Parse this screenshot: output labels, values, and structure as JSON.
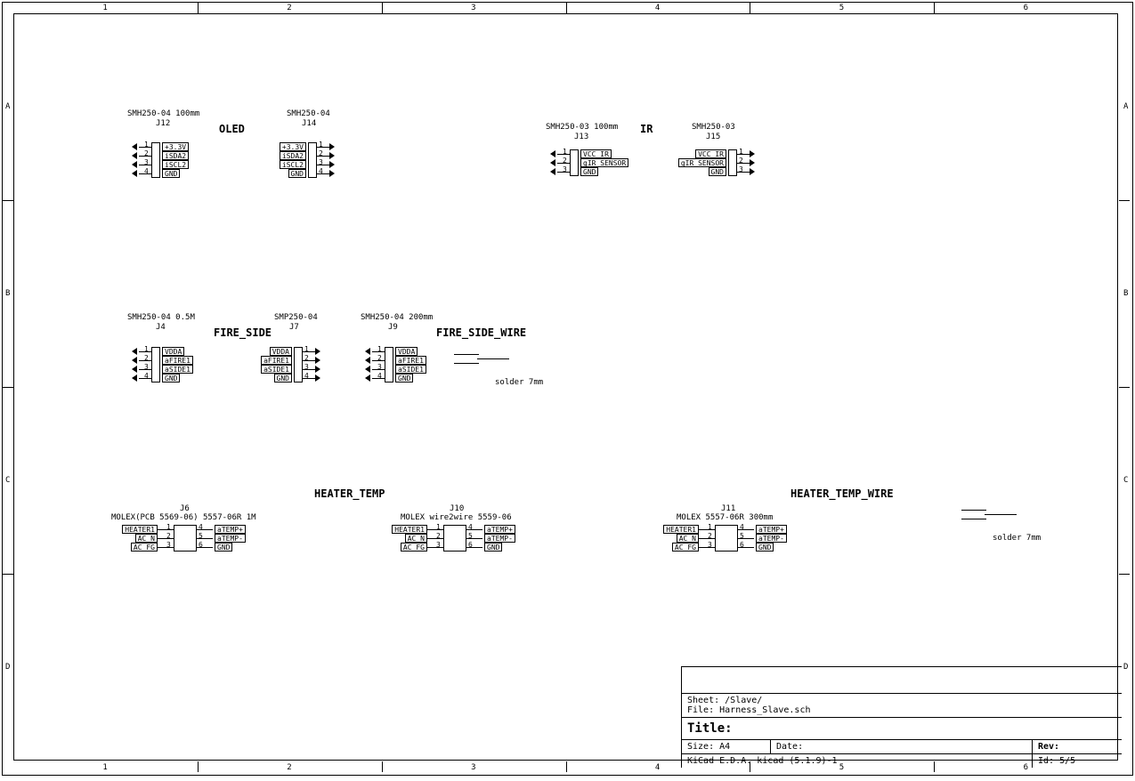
{
  "zones": {
    "cols": [
      "1",
      "2",
      "3",
      "4",
      "5",
      "6"
    ],
    "rows": [
      "A",
      "B",
      "C",
      "D"
    ]
  },
  "groups": {
    "oled": "OLED",
    "ir": "IR",
    "fireside": "FIRE_SIDE",
    "firesidewire": "FIRE_SIDE_WIRE",
    "heatertemp": "HEATER_TEMP",
    "heatertempwire": "HEATER_TEMP_WIRE"
  },
  "solder": {
    "label": "solder 7mm"
  },
  "connectors": {
    "J12": {
      "ref": "J12",
      "val": "SMH250-04 100mm",
      "pins": [
        {
          "n": "1",
          "net": "+3.3V"
        },
        {
          "n": "2",
          "net": "iSDA2"
        },
        {
          "n": "3",
          "net": "iSCL2"
        },
        {
          "n": "4",
          "net": "GND"
        }
      ]
    },
    "J14": {
      "ref": "J14",
      "val": "SMH250-04",
      "pins": [
        {
          "n": "1",
          "net": "+3.3V"
        },
        {
          "n": "2",
          "net": "iSDA2"
        },
        {
          "n": "3",
          "net": "iSCL2"
        },
        {
          "n": "4",
          "net": "GND"
        }
      ]
    },
    "J13": {
      "ref": "J13",
      "val": "SMH250-03 100mm",
      "pins": [
        {
          "n": "1",
          "net": "VCC_IR"
        },
        {
          "n": "2",
          "net": "gIR_SENSOR"
        },
        {
          "n": "3",
          "net": "GND"
        }
      ]
    },
    "J15": {
      "ref": "J15",
      "val": "SMH250-03",
      "pins": [
        {
          "n": "1",
          "net": "VCC_IR"
        },
        {
          "n": "2",
          "net": "gIR_SENSOR"
        },
        {
          "n": "3",
          "net": "GND"
        }
      ]
    },
    "J4": {
      "ref": "J4",
      "val": "SMH250-04 0.5M",
      "pins": [
        {
          "n": "1",
          "net": "VDDA"
        },
        {
          "n": "2",
          "net": "aFIRE1"
        },
        {
          "n": "3",
          "net": "aSIDE1"
        },
        {
          "n": "4",
          "net": "GND"
        }
      ]
    },
    "J7": {
      "ref": "J7",
      "val": "SMP250-04",
      "pins": [
        {
          "n": "1",
          "net": "VDDA"
        },
        {
          "n": "2",
          "net": "aFIRE1"
        },
        {
          "n": "3",
          "net": "aSIDE1"
        },
        {
          "n": "4",
          "net": "GND"
        }
      ]
    },
    "J9": {
      "ref": "J9",
      "val": "SMH250-04 200mm",
      "pins": [
        {
          "n": "1",
          "net": "VDDA"
        },
        {
          "n": "2",
          "net": "aFIRE1"
        },
        {
          "n": "3",
          "net": "aSIDE1"
        },
        {
          "n": "4",
          "net": "GND"
        }
      ]
    },
    "J6": {
      "ref": "J6",
      "val": "MOLEX(PCB 5569-06) 5557-06R 1M",
      "lpins": [
        {
          "n": "1",
          "net": "HEATER1"
        },
        {
          "n": "2",
          "net": "AC_N"
        },
        {
          "n": "3",
          "net": "AC_FG"
        }
      ],
      "rpins": [
        {
          "n": "4",
          "net": "aTEMP+"
        },
        {
          "n": "5",
          "net": "aTEMP-"
        },
        {
          "n": "6",
          "net": "GND"
        }
      ]
    },
    "J10": {
      "ref": "J10",
      "val": "MOLEX wire2wire 5559-06",
      "lpins": [
        {
          "n": "1",
          "net": "HEATER1"
        },
        {
          "n": "2",
          "net": "AC_N"
        },
        {
          "n": "3",
          "net": "AC_FG"
        }
      ],
      "rpins": [
        {
          "n": "4",
          "net": "aTEMP+"
        },
        {
          "n": "5",
          "net": "aTEMP-"
        },
        {
          "n": "6",
          "net": "GND"
        }
      ]
    },
    "J11": {
      "ref": "J11",
      "val": "MOLEX 5557-06R 300mm",
      "lpins": [
        {
          "n": "1",
          "net": "HEATER1"
        },
        {
          "n": "2",
          "net": "AC_N"
        },
        {
          "n": "3",
          "net": "AC_FG"
        }
      ],
      "rpins": [
        {
          "n": "4",
          "net": "aTEMP+"
        },
        {
          "n": "5",
          "net": "aTEMP-"
        },
        {
          "n": "6",
          "net": "GND"
        }
      ]
    }
  },
  "titleblock": {
    "sheet_label": "Sheet:",
    "sheet": "/Slave/",
    "file_label": "File:",
    "file": "Harness_Slave.sch",
    "title_label": "Title:",
    "title": "",
    "size_label": "Size:",
    "size": "A4",
    "date_label": "Date:",
    "date": "",
    "rev_label": "Rev:",
    "rev": "",
    "gen": "KiCad E.D.A.  kicad (5.1.9)-1",
    "id_label": "Id:",
    "id": "5/5"
  }
}
